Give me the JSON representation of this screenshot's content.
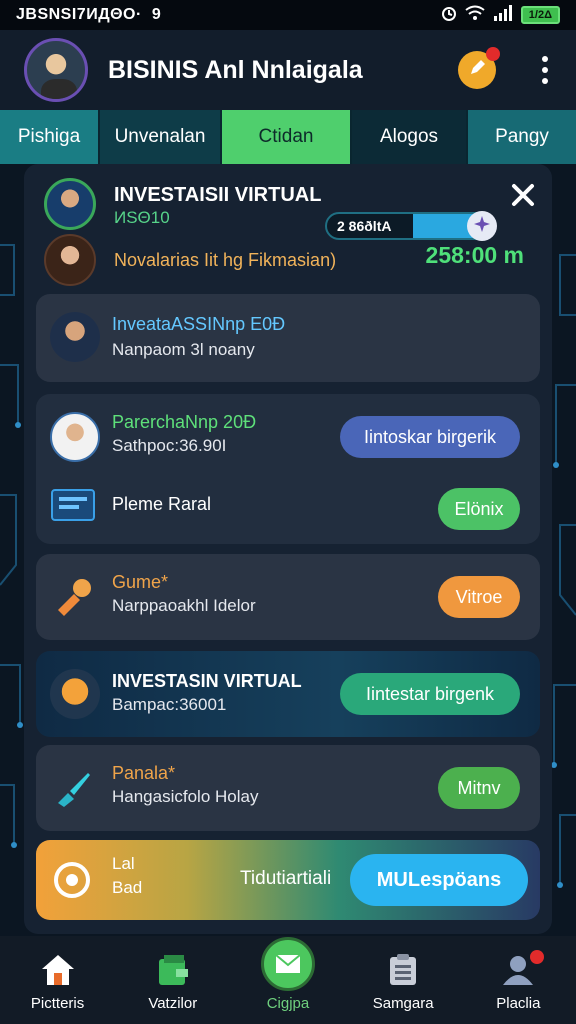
{
  "status_bar": {
    "left_text": "JBSNSI7ИДΘО·",
    "left_icon": "9",
    "battery": "1/2Δ"
  },
  "header": {
    "title": "BISINIS Anl Nnlaigala"
  },
  "tabs": [
    "Pishiga",
    "Unvenalan",
    "Ctidan",
    "Alogos",
    "Pangy"
  ],
  "panel": {
    "title": "INVESTAISII VIRTUAL",
    "subtitle": "ИЅΘ10",
    "description": "Novalarias Iit hg Fikmasian)",
    "amount": "258:00 m"
  },
  "cards": [
    {
      "title": "InveataASSINnp E0Ð",
      "subtitle": "Nanpaom 3l noany",
      "title_color": "#64c8ff"
    },
    {
      "title": "ParerchaNnp 20Ð",
      "subtitle": "Sathpoc:36.90I",
      "button": "Iintoskar birgerik",
      "title_color": "#5ee07a"
    },
    {
      "title": "Pleme Raral",
      "button": "Elönix"
    },
    {
      "title": "Gume*",
      "subtitle": "Narppaoakhl Idelor",
      "button": "Vitroe",
      "title_color": "#f0a44a"
    },
    {
      "title": "INVESTASIN VIRTUAL",
      "subtitle": "Bampac:36001",
      "button": "Iintestar birgenk"
    },
    {
      "title": "Panala*",
      "subtitle": "Hangasicfolo Holay",
      "button": "Mitnv",
      "title_color": "#f0a44a"
    },
    {
      "line1": "Lal",
      "line2": "Bad",
      "middle": "Tidutiartiali",
      "button": "MULespöans"
    }
  ],
  "progress": {
    "label": "2 86ðltA",
    "value": 0.48
  },
  "bottom_nav": [
    "Pictteris",
    "Vatzilor",
    "Cigjpa",
    "Samgara",
    "Placlia"
  ],
  "colors": {
    "accent_green": "#4fcf6d",
    "button_blue": "#4a66b8",
    "button_green": "#4cc266",
    "button_orange": "#f0983e",
    "button_teal": "#2aa87a",
    "button_cyan": "#2ab4f0"
  }
}
